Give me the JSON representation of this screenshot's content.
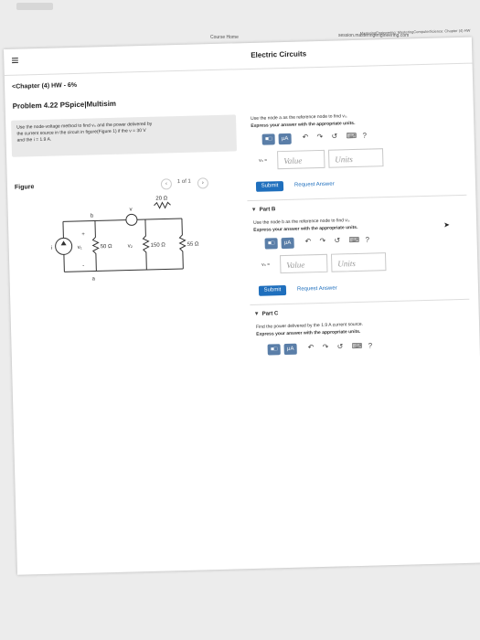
{
  "topbar": {
    "url": "session.masteringengineering.com",
    "course_home": "Course Home",
    "tab_title": "MasteringEngineering: MasteringComputerScience: Chapter (4) HW"
  },
  "header": {
    "title": "Electric Circuits"
  },
  "breadcrumb": {
    "chapter": "<Chapter (4) HW - 6%"
  },
  "problem": {
    "title": "Problem 4.22 PSpice|Multisim",
    "instructions": "Use the node-voltage method to find v₀ and the power delivered by the current source in the circuit in figure(Figure 1) if the ν = 30 V and the i = 1.9 A.",
    "figure_label": "Figure",
    "pager": "1 of 1"
  },
  "circuit": {
    "r_top": "20 Ω",
    "r1": "50 Ω",
    "r2": "150 Ω",
    "r3": "55 Ω",
    "node_b": "b",
    "node_a": "a",
    "src_v": "v",
    "src_i": "i",
    "v1": "v₁",
    "v2": "v₂",
    "plus": "+",
    "minus": "-"
  },
  "part_a": {
    "prompt": "Use the node a as the reference node to find v₀.",
    "express": "Express your answer with the appropriate units.",
    "var": "v₀ =",
    "value_placeholder": "Value",
    "units_placeholder": "Units",
    "submit": "Submit",
    "request": "Request Answer"
  },
  "part_b": {
    "label": "Part B",
    "prompt": "Use the node b as the reference node to find v₀.",
    "express": "Express your answer with the appropriate units.",
    "var": "v₀ =",
    "value_placeholder": "Value",
    "units_placeholder": "Units",
    "submit": "Submit",
    "request": "Request Answer"
  },
  "part_c": {
    "label": "Part C",
    "prompt": "Find the power delivered by the 1.9 A current source.",
    "express": "Express your answer with the appropriate units."
  },
  "toolbar": {
    "templates": "■□",
    "mu_a": "μA",
    "undo": "↶",
    "redo": "↷",
    "reset": "↺",
    "keyboard": "⌨",
    "help": "?"
  },
  "menu_icon": "≡"
}
